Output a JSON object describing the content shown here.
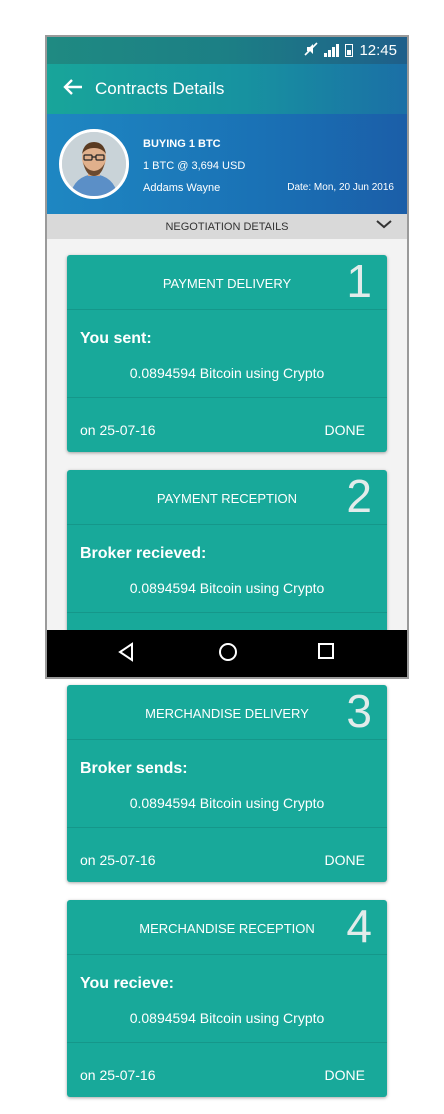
{
  "status_bar": {
    "time": "12:45",
    "icons": [
      "mute-icon",
      "signal-icon",
      "battery-icon"
    ]
  },
  "app_bar": {
    "title": "Contracts Details"
  },
  "contract": {
    "title": "BUYING 1 BTC",
    "rate": "1 BTC @ 3,694 USD",
    "name": "Addams Wayne",
    "date": "Date: Mon, 20 Jun 2016"
  },
  "negotiation_bar": {
    "label": "NEGOTIATION DETAILS"
  },
  "cards": [
    {
      "title": "PAYMENT DELIVERY",
      "number": "1",
      "who": "You sent:",
      "amount": "0.0894594 Bitcoin using Crypto",
      "date": "on 25-07-16",
      "status": "DONE"
    },
    {
      "title": "PAYMENT RECEPTION",
      "number": "2",
      "who": "Broker recieved:",
      "amount": "0.0894594 Bitcoin using Crypto",
      "date": "",
      "status": ""
    },
    {
      "title": "MERCHANDISE DELIVERY",
      "number": "3",
      "who": "Broker sends:",
      "amount": "0.0894594 Bitcoin using Crypto",
      "date": "on 25-07-16",
      "status": "DONE"
    },
    {
      "title": "MERCHANDISE RECEPTION",
      "number": "4",
      "who": "You recieve:",
      "amount": "0.0894594 Bitcoin using Crypto",
      "date": "on 25-07-16",
      "status": "DONE"
    }
  ],
  "colors": {
    "card": "#18a99a",
    "header_blue": "#1a71b5",
    "teal": "#18a59a"
  }
}
